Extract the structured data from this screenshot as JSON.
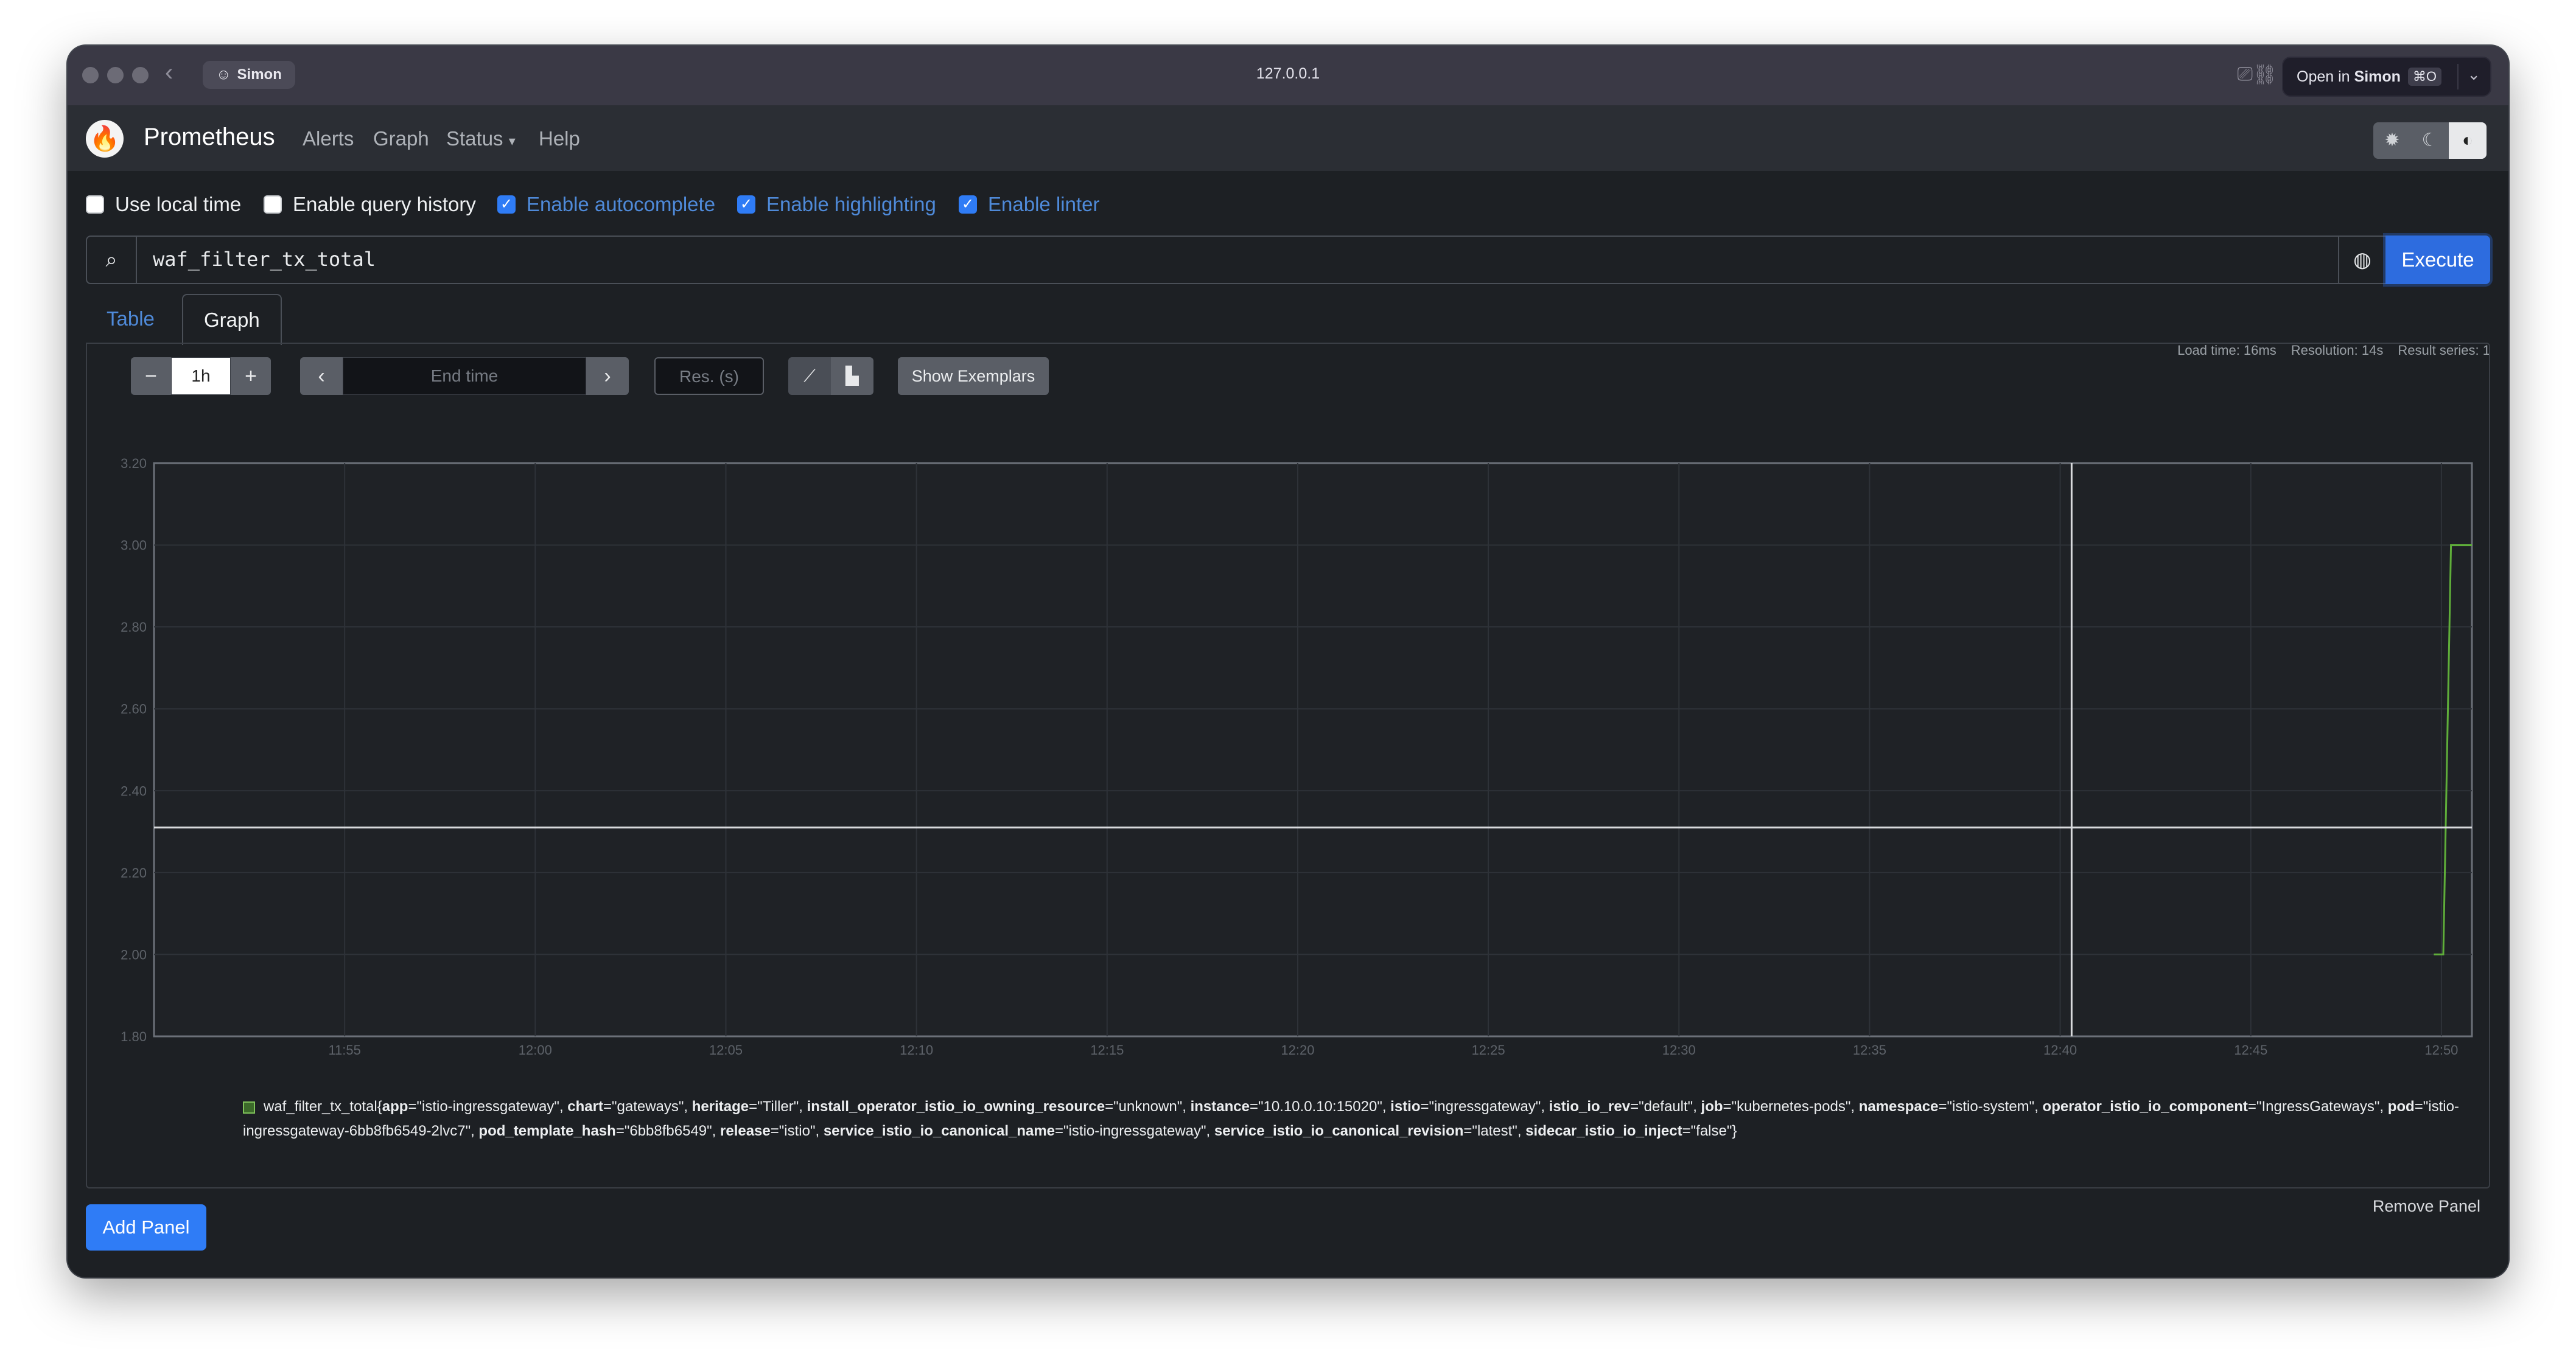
{
  "browser": {
    "profile": "Simon",
    "url": "127.0.0.1",
    "open_in_prefix": "Open in",
    "open_in_profile": "Simon",
    "open_in_shortcut": "⌘O"
  },
  "navbar": {
    "brand": "Prometheus",
    "links": [
      "Alerts",
      "Graph",
      "Status",
      "Help"
    ]
  },
  "options": [
    {
      "label": "Use local time",
      "checked": false
    },
    {
      "label": "Enable query history",
      "checked": false
    },
    {
      "label": "Enable autocomplete",
      "checked": true
    },
    {
      "label": "Enable highlighting",
      "checked": true
    },
    {
      "label": "Enable linter",
      "checked": true
    }
  ],
  "query": {
    "expression": "waf_filter_tx_total",
    "execute_label": "Execute"
  },
  "tabs": {
    "table": "Table",
    "graph": "Graph"
  },
  "stats": {
    "load_time": "Load time: 16ms",
    "resolution": "Resolution: 14s",
    "result_series": "Result series: 1"
  },
  "controls": {
    "range_minus": "−",
    "range_value": "1h",
    "range_plus": "+",
    "end_time_placeholder": "End time",
    "res_placeholder": "Res. (s)",
    "show_exemplars": "Show Exemplars"
  },
  "chart_data": {
    "type": "line",
    "x_ticks": [
      "11:55",
      "12:00",
      "12:05",
      "12:10",
      "12:15",
      "12:20",
      "12:25",
      "12:30",
      "12:35",
      "12:40",
      "12:45",
      "12:50"
    ],
    "y_ticks": [
      "3.20",
      "3.00",
      "2.80",
      "2.60",
      "2.40",
      "2.20",
      "2.00",
      "1.80"
    ],
    "ylim": [
      1.8,
      3.2
    ],
    "xlim_minutes": [
      -60.8,
      0
    ],
    "crosshair": {
      "x_minutes": -10.5,
      "y": 2.31
    },
    "series": [
      {
        "color": "#5fae3a",
        "points": [
          {
            "t": -1.0,
            "v": 2.0
          },
          {
            "t": -0.75,
            "v": 2.0
          },
          {
            "t": -0.55,
            "v": 3.0
          },
          {
            "t": 0.0,
            "v": 3.0
          }
        ]
      }
    ]
  },
  "legend": {
    "metric": "waf_filter_tx_total",
    "labels": [
      [
        "app",
        "istio-ingressgateway"
      ],
      [
        "chart",
        "gateways"
      ],
      [
        "heritage",
        "Tiller"
      ],
      [
        "install_operator_istio_io_owning_resource",
        "unknown"
      ],
      [
        "instance",
        "10.10.0.10:15020"
      ],
      [
        "istio",
        "ingressgateway"
      ],
      [
        "istio_io_rev",
        "default"
      ],
      [
        "job",
        "kubernetes-pods"
      ],
      [
        "namespace",
        "istio-system"
      ],
      [
        "operator_istio_io_component",
        "IngressGateways"
      ],
      [
        "pod",
        "istio-ingressgateway-6bb8fb6549-2lvc7"
      ],
      [
        "pod_template_hash",
        "6bb8fb6549"
      ],
      [
        "release",
        "istio"
      ],
      [
        "service_istio_io_canonical_name",
        "istio-ingressgateway"
      ],
      [
        "service_istio_io_canonical_revision",
        "latest"
      ],
      [
        "sidecar_istio_io_inject",
        "false"
      ]
    ]
  },
  "footer": {
    "remove_panel": "Remove Panel",
    "add_panel": "Add Panel"
  },
  "colors": {
    "accent": "#2f7cf6",
    "link": "#4f8ad9",
    "background": "#1d2024",
    "series": "#5fae3a"
  }
}
